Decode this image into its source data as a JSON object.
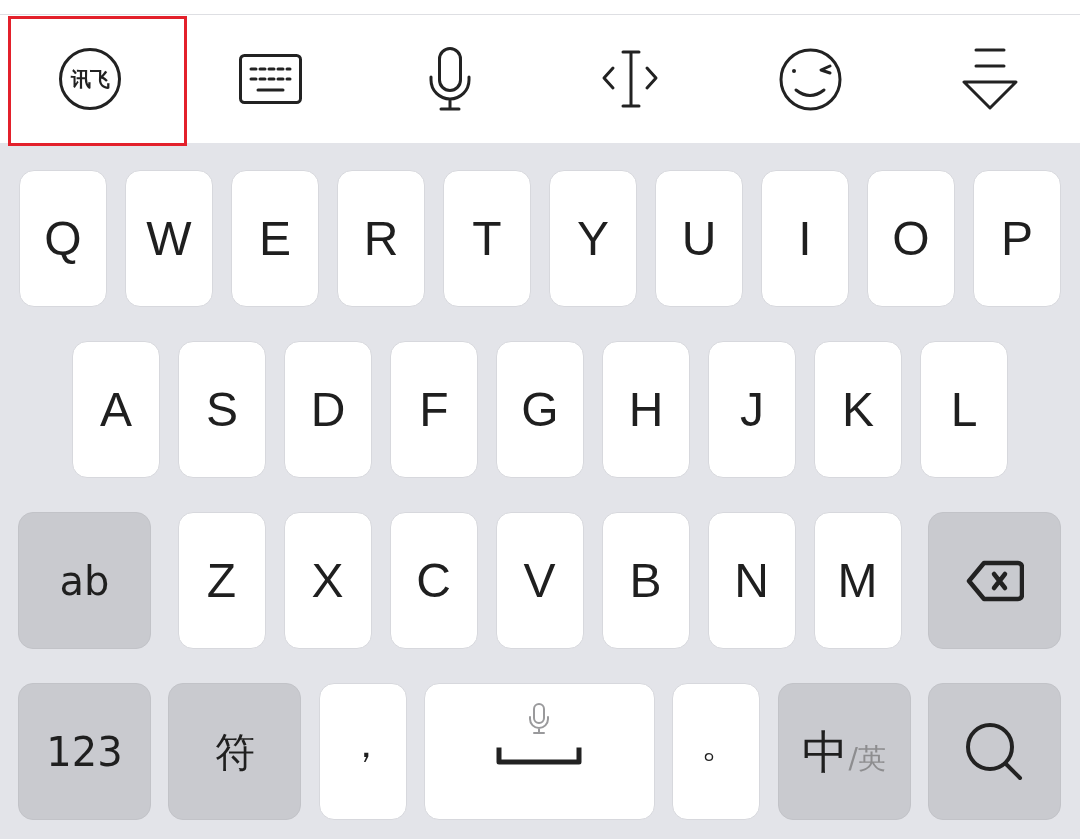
{
  "toolbar": {
    "items": [
      {
        "kind": "logo",
        "text": "讯飞",
        "highlighted": true
      },
      {
        "kind": "keyboard",
        "highlighted": false
      },
      {
        "kind": "microphone",
        "highlighted": false
      },
      {
        "kind": "cursor",
        "highlighted": false
      },
      {
        "kind": "emoji",
        "highlighted": false
      },
      {
        "kind": "collapse",
        "highlighted": false
      }
    ]
  },
  "keyboard": {
    "rows": [
      {
        "keys": [
          {
            "kind": "letter",
            "label": "Q"
          },
          {
            "kind": "letter",
            "label": "W"
          },
          {
            "kind": "letter",
            "label": "E"
          },
          {
            "kind": "letter",
            "label": "R"
          },
          {
            "kind": "letter",
            "label": "T"
          },
          {
            "kind": "letter",
            "label": "Y"
          },
          {
            "kind": "letter",
            "label": "U"
          },
          {
            "kind": "letter",
            "label": "I"
          },
          {
            "kind": "letter",
            "label": "O"
          },
          {
            "kind": "letter",
            "label": "P"
          }
        ]
      },
      {
        "keys": [
          {
            "kind": "letter",
            "label": "A"
          },
          {
            "kind": "letter",
            "label": "S"
          },
          {
            "kind": "letter",
            "label": "D"
          },
          {
            "kind": "letter",
            "label": "F"
          },
          {
            "kind": "letter",
            "label": "G"
          },
          {
            "kind": "letter",
            "label": "H"
          },
          {
            "kind": "letter",
            "label": "J"
          },
          {
            "kind": "letter",
            "label": "K"
          },
          {
            "kind": "letter",
            "label": "L"
          }
        ]
      },
      {
        "keys": [
          {
            "kind": "mode",
            "label": "ab"
          },
          {
            "kind": "letter",
            "label": "Z"
          },
          {
            "kind": "letter",
            "label": "X"
          },
          {
            "kind": "letter",
            "label": "C"
          },
          {
            "kind": "letter",
            "label": "V"
          },
          {
            "kind": "letter",
            "label": "B"
          },
          {
            "kind": "letter",
            "label": "N"
          },
          {
            "kind": "letter",
            "label": "M"
          },
          {
            "kind": "backspace"
          }
        ]
      },
      {
        "keys": [
          {
            "kind": "mode",
            "label": "123"
          },
          {
            "kind": "mode",
            "label": "符"
          },
          {
            "kind": "punct",
            "label": "，"
          },
          {
            "kind": "space"
          },
          {
            "kind": "punct",
            "label": "。"
          },
          {
            "kind": "language",
            "label": "中",
            "secondary": "/英"
          },
          {
            "kind": "search"
          }
        ]
      }
    ]
  }
}
